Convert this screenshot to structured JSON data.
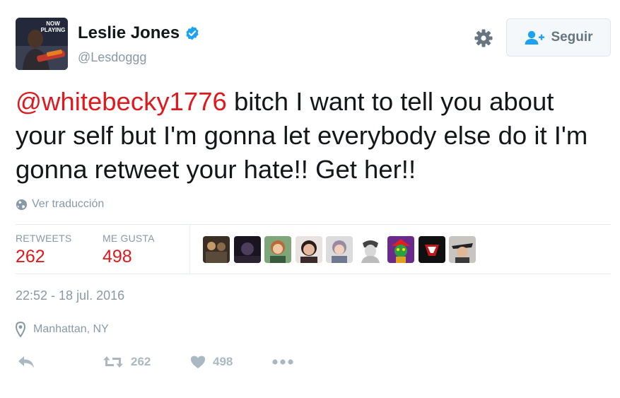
{
  "user": {
    "name": "Leslie Jones",
    "handle": "@Lesdoggg",
    "avatar_badge": "NOW PLAYING"
  },
  "follow": {
    "label": "Seguir"
  },
  "tweet": {
    "mention": "@whitebecky1776",
    "text": " bitch I want to tell you about your self but I'm gonna let everybody else do it I'm gonna retweet your hate!! Get her!!"
  },
  "translate": {
    "label": "Ver traducción"
  },
  "stats": {
    "retweets_label": "RETWEETS",
    "retweets_value": "262",
    "likes_label": "ME GUSTA",
    "likes_value": "498"
  },
  "timestamp": "22:52 - 18 jul. 2016",
  "location": "Manhattan, NY",
  "actions": {
    "retweet_count": "262",
    "like_count": "498"
  },
  "colors": {
    "accent": "#e0191e",
    "verified": "#1da1f2",
    "muted": "#8899a6",
    "icon": "#aab8c2"
  },
  "icons": [
    "verified-icon",
    "gear-icon",
    "add-user-icon",
    "globe-icon",
    "pin-icon",
    "reply-icon",
    "retweet-icon",
    "heart-icon",
    "more-icon"
  ]
}
